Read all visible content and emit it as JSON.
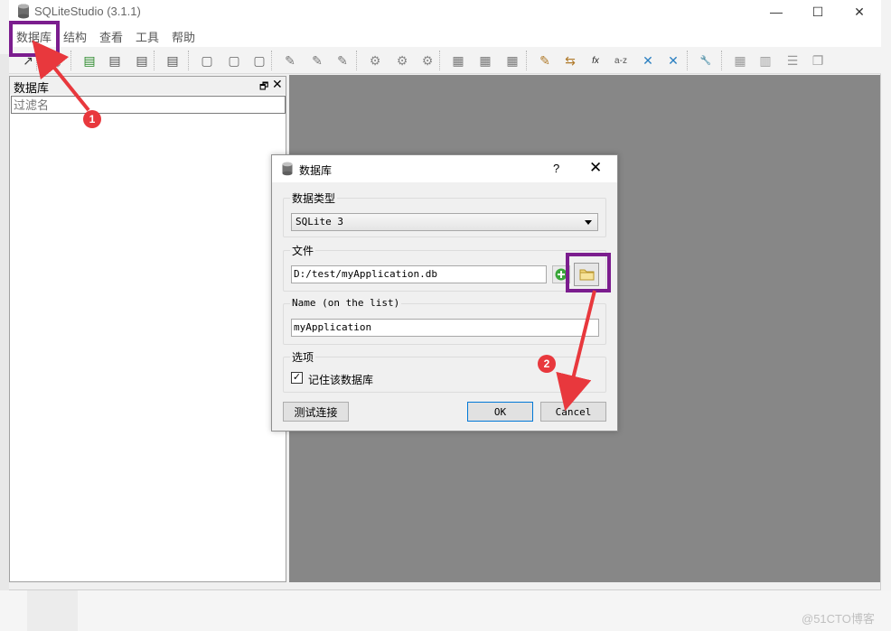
{
  "window": {
    "title": "SQLiteStudio (3.1.1)",
    "minimize": "—",
    "maximize": "☐",
    "close": "✕"
  },
  "menu": [
    "数据库",
    "结构",
    "查看",
    "工具",
    "帮助"
  ],
  "dock": {
    "title": "数据库",
    "float_icon": "🗗",
    "close_icon": "✕",
    "filter_placeholder": "过滤名"
  },
  "dialog": {
    "title": "数据库",
    "help": "?",
    "close": "✕",
    "db_type_label": "数据类型",
    "db_type_value": "SQLite 3",
    "file_label": "文件",
    "file_value": "D:/test/myApplication.db",
    "name_label": "Name (on the list)",
    "name_value": "myApplication",
    "options_label": "选项",
    "remember_checked": true,
    "remember_label": "记住该数据库",
    "test_button": "测试连接",
    "ok_button": "OK",
    "cancel_button": "Cancel"
  },
  "annotations": {
    "steps": [
      "1",
      "2"
    ],
    "highlight_color": "#7b1d8e",
    "arrow_color": "#e8383d"
  },
  "watermark": "@51CTO博客",
  "toolbar_icons": [
    "connect-icon",
    "disconnect-icon",
    "add-database-icon",
    "edit-database-icon",
    "remove-database-icon",
    "refresh-icon",
    "new-table-icon",
    "edit-table-icon",
    "delete-table-icon",
    "new-index-icon",
    "edit-index-icon",
    "delete-index-icon",
    "new-trigger-icon",
    "edit-trigger-icon",
    "delete-trigger-icon",
    "new-view-icon",
    "edit-view-icon",
    "delete-view-icon",
    "sql-editor-icon",
    "export-icon",
    "functions-icon",
    "collations-icon",
    "tile-icon",
    "cascade-icon",
    "settings-icon",
    "layout-grid-icon",
    "layout-columns-icon",
    "layout-rows-icon",
    "layout-tabs-icon"
  ]
}
